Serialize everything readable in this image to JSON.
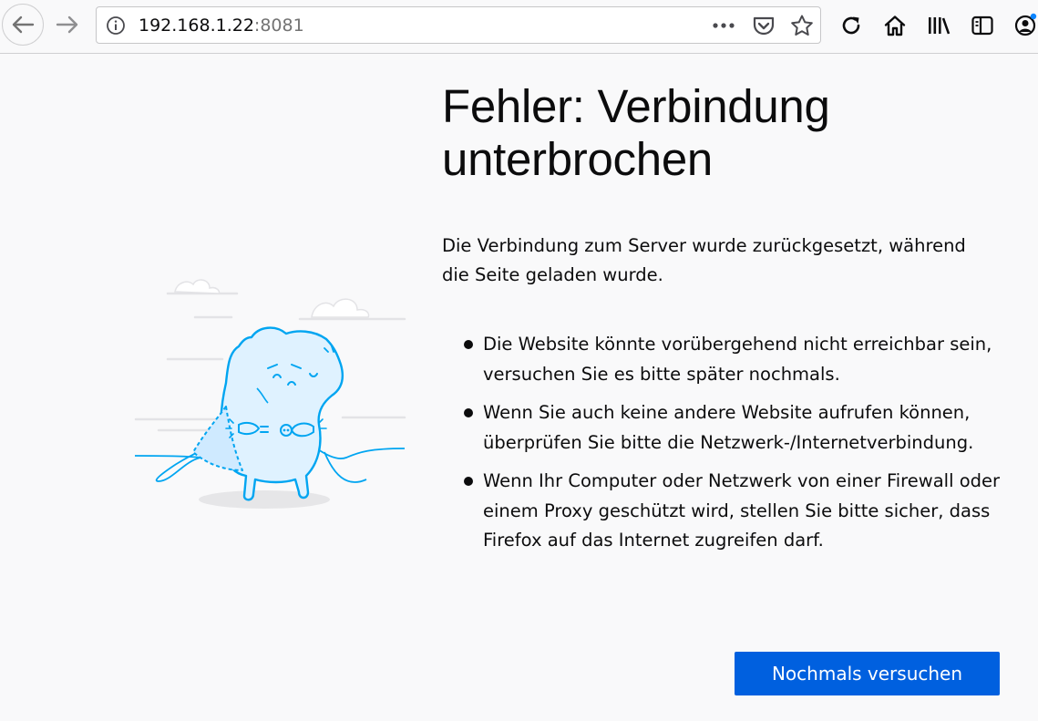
{
  "toolbar": {
    "url_host": "192.168.1.22",
    "url_port": ":8081",
    "icons": [
      "back-arrow-icon",
      "forward-arrow-icon",
      "info-icon",
      "more-icon",
      "pocket-icon",
      "star-icon",
      "reload-icon",
      "home-icon",
      "library-icon",
      "sidebar-icon",
      "account-icon"
    ]
  },
  "error_page": {
    "title": "Fehler: Verbindung unterbrochen",
    "description": "Die Verbindung zum Server wurde zurückgesetzt, während die Seite geladen wurde.",
    "suggestions": [
      "Die Website könnte vorübergehend nicht erreichbar sein, versuchen Sie es bitte später nochmals.",
      "Wenn Sie auch keine andere Website aufrufen können, überprüfen Sie bitte die Netzwerk-/Internetverbindung.",
      "Wenn Ihr Computer oder Netzwerk von einer Firewall oder einem Proxy geschützt wird, stellen Sie bitte sicher, dass Firefox auf das Internet zugreifen darf."
    ],
    "retry_label": "Nochmals versuchen"
  },
  "colors": {
    "accent": "#0060df",
    "illustration": "#00a5f1",
    "background": "#f9f9fa"
  }
}
